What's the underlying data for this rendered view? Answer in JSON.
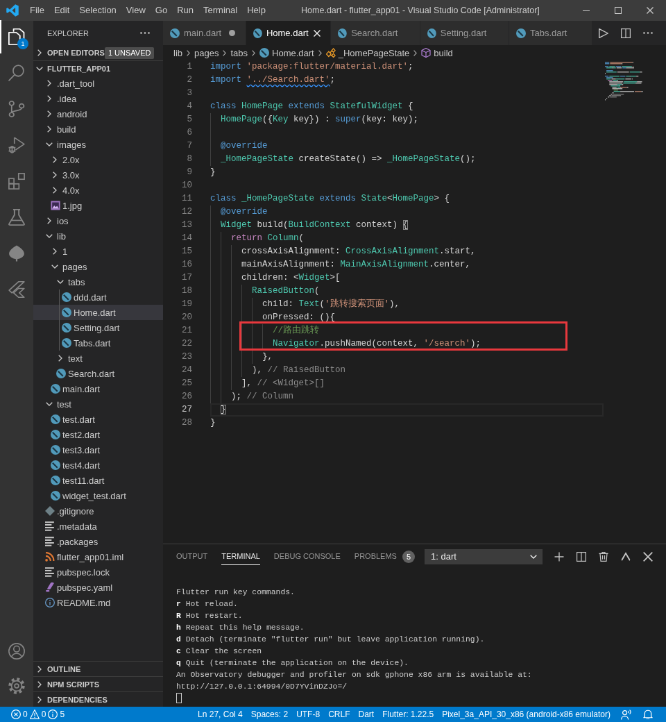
{
  "window": {
    "title": "Home.dart - flutter_app01 - Visual Studio Code [Administrator]"
  },
  "menu": [
    "File",
    "Edit",
    "Selection",
    "View",
    "Go",
    "Run",
    "Terminal",
    "Help"
  ],
  "activity_bar": {
    "items": [
      {
        "kind": "explorer",
        "selected": true,
        "badge": "1"
      },
      {
        "kind": "search",
        "selected": false
      },
      {
        "kind": "source-control",
        "selected": false
      },
      {
        "kind": "run-debug",
        "selected": false
      },
      {
        "kind": "extensions",
        "selected": false
      },
      {
        "kind": "testing",
        "selected": false
      },
      {
        "kind": "leaf",
        "selected": false
      },
      {
        "kind": "flutter",
        "selected": false
      }
    ],
    "bottom": [
      {
        "kind": "account"
      },
      {
        "kind": "settings"
      }
    ]
  },
  "sidebar": {
    "title": "EXPLORER",
    "open_editors": {
      "label": "OPEN EDITORS",
      "expanded": false,
      "badge": "1 UNSAVED"
    },
    "folder": {
      "label": "FLUTTER_APP01",
      "expanded": true,
      "items": [
        {
          "name": ".dart_tool",
          "kind": "folder",
          "expanded": false,
          "selected": false
        },
        {
          "name": ".idea",
          "kind": "folder",
          "expanded": false,
          "selected": false
        },
        {
          "name": "android",
          "kind": "folder",
          "expanded": false,
          "selected": false
        },
        {
          "name": "build",
          "kind": "folder",
          "expanded": false,
          "selected": false
        },
        {
          "name": "images",
          "kind": "folder",
          "expanded": true,
          "selected": false,
          "children": [
            {
              "name": "2.0x",
              "kind": "folder",
              "expanded": false,
              "selected": false
            },
            {
              "name": "3.0x",
              "kind": "folder",
              "expanded": false,
              "selected": false
            },
            {
              "name": "4.0x",
              "kind": "folder",
              "expanded": false,
              "selected": false
            },
            {
              "name": "1.jpg",
              "kind": "image",
              "selected": false
            }
          ]
        },
        {
          "name": "ios",
          "kind": "folder",
          "expanded": false,
          "selected": false
        },
        {
          "name": "lib",
          "kind": "folder",
          "expanded": true,
          "selected": false,
          "children": [
            {
              "name": "1",
              "kind": "folder",
              "expanded": false,
              "selected": false
            },
            {
              "name": "pages",
              "kind": "folder",
              "expanded": true,
              "selected": false,
              "children": [
                {
                  "name": "tabs",
                  "kind": "folder",
                  "expanded": true,
                  "selected": false,
                  "children": [
                    {
                      "name": "ddd.dart",
                      "kind": "dart",
                      "selected": false
                    },
                    {
                      "name": "Home.dart",
                      "kind": "dart",
                      "selected": true
                    },
                    {
                      "name": "Setting.dart",
                      "kind": "dart",
                      "selected": false
                    },
                    {
                      "name": "Tabs.dart",
                      "kind": "dart",
                      "selected": false
                    }
                  ]
                },
                {
                  "name": "text",
                  "kind": "folder",
                  "expanded": false,
                  "selected": false
                },
                {
                  "name": "Search.dart",
                  "kind": "dart",
                  "selected": false
                }
              ]
            },
            {
              "name": "main.dart",
              "kind": "dart",
              "selected": false
            }
          ]
        },
        {
          "name": "test",
          "kind": "folder",
          "expanded": true,
          "selected": false,
          "children": [
            {
              "name": "test.dart",
              "kind": "dart",
              "selected": false
            },
            {
              "name": "test2.dart",
              "kind": "dart",
              "selected": false
            },
            {
              "name": "test3.dart",
              "kind": "dart",
              "selected": false
            },
            {
              "name": "test4.dart",
              "kind": "dart",
              "selected": false
            },
            {
              "name": "test11.dart",
              "kind": "dart",
              "selected": false
            },
            {
              "name": "widget_test.dart",
              "kind": "dart",
              "selected": false
            }
          ]
        },
        {
          "name": ".gitignore",
          "kind": "git",
          "selected": false
        },
        {
          "name": ".metadata",
          "kind": "text",
          "selected": false
        },
        {
          "name": ".packages",
          "kind": "text",
          "selected": false
        },
        {
          "name": "flutter_app01.iml",
          "kind": "rss",
          "selected": false
        },
        {
          "name": "pubspec.lock",
          "kind": "text",
          "selected": false
        },
        {
          "name": "pubspec.yaml",
          "kind": "yaml",
          "selected": false
        },
        {
          "name": "README.md",
          "kind": "info",
          "selected": false
        }
      ]
    },
    "sections": [
      {
        "label": "OUTLINE",
        "expanded": false
      },
      {
        "label": "NPM SCRIPTS",
        "expanded": false
      },
      {
        "label": "DEPENDENCIES",
        "expanded": false
      }
    ]
  },
  "editor": {
    "tabs": [
      {
        "label": "main.dart",
        "selected": false,
        "dirty": true
      },
      {
        "label": "Home.dart",
        "selected": true,
        "dirty": false
      },
      {
        "label": "Search.dart",
        "selected": false,
        "dirty": false
      },
      {
        "label": "Setting.dart",
        "selected": false,
        "dirty": false
      },
      {
        "label": "Tabs.dart",
        "selected": false,
        "dirty": false
      }
    ],
    "breadcrumbs": [
      {
        "label": "lib",
        "kind": "folder"
      },
      {
        "label": "pages",
        "kind": "folder"
      },
      {
        "label": "tabs",
        "kind": "folder"
      },
      {
        "label": "Home.dart",
        "kind": "dart"
      },
      {
        "label": "_HomePageState",
        "kind": "class"
      },
      {
        "label": "build",
        "kind": "method"
      }
    ],
    "lines": [
      {
        "number": "1",
        "current": false,
        "boxed": false,
        "tokens": [
          {
            "kind": "keyword",
            "text": "import "
          },
          {
            "kind": "string",
            "text": "'package:flutter/material.dart'"
          },
          {
            "kind": "plain",
            "text": ";"
          }
        ]
      },
      {
        "number": "2",
        "current": false,
        "boxed": false,
        "tokens": [
          {
            "kind": "keyword",
            "text": "import "
          },
          {
            "kind": "flagged-string",
            "text": "'../Search.dart'"
          },
          {
            "kind": "plain",
            "text": ";"
          }
        ]
      },
      {
        "number": "3",
        "current": false,
        "boxed": false
      },
      {
        "number": "4",
        "current": false,
        "boxed": false,
        "tokens": [
          {
            "kind": "keyword",
            "text": "class "
          },
          {
            "kind": "type",
            "text": "HomePage"
          },
          {
            "kind": "keyword",
            "text": " extends "
          },
          {
            "kind": "type",
            "text": "StatefulWidget"
          },
          {
            "kind": "plain",
            "text": " {"
          }
        ]
      },
      {
        "number": "5",
        "current": false,
        "boxed": false,
        "tokens": [
          {
            "kind": "type",
            "text": "  HomePage"
          },
          {
            "kind": "plain",
            "text": "({"
          },
          {
            "kind": "type",
            "text": "Key"
          },
          {
            "kind": "plain",
            "text": " key}) : "
          },
          {
            "kind": "keyword",
            "text": "super"
          },
          {
            "kind": "plain",
            "text": "(key: key);"
          }
        ]
      },
      {
        "number": "6",
        "current": false,
        "boxed": false
      },
      {
        "number": "7",
        "current": false,
        "boxed": false,
        "tokens": [
          {
            "kind": "annotation",
            "text": "  @override"
          }
        ]
      },
      {
        "number": "8",
        "current": false,
        "boxed": false,
        "tokens": [
          {
            "kind": "type",
            "text": "  _HomePageState"
          },
          {
            "kind": "plain",
            "text": " createState() => "
          },
          {
            "kind": "type",
            "text": "_HomePageState"
          },
          {
            "kind": "plain",
            "text": "();"
          }
        ]
      },
      {
        "number": "9",
        "current": false,
        "boxed": false,
        "tokens": [
          {
            "kind": "plain",
            "text": "}"
          }
        ]
      },
      {
        "number": "10",
        "current": false,
        "boxed": false
      },
      {
        "number": "11",
        "current": false,
        "boxed": false,
        "tokens": [
          {
            "kind": "keyword",
            "text": "class "
          },
          {
            "kind": "type",
            "text": "_HomePageState"
          },
          {
            "kind": "keyword",
            "text": " extends "
          },
          {
            "kind": "type",
            "text": "State"
          },
          {
            "kind": "plain",
            "text": "<"
          },
          {
            "kind": "type",
            "text": "HomePage"
          },
          {
            "kind": "plain",
            "text": "> {"
          }
        ]
      },
      {
        "number": "12",
        "current": false,
        "boxed": false,
        "tokens": [
          {
            "kind": "annotation",
            "text": "  @override"
          }
        ]
      },
      {
        "number": "13",
        "current": false,
        "boxed": false,
        "tokens": [
          {
            "kind": "type",
            "text": "  Widget"
          },
          {
            "kind": "plain",
            "text": " build("
          },
          {
            "kind": "type",
            "text": "BuildContext"
          },
          {
            "kind": "plain",
            "text": " context) "
          },
          {
            "kind": "bracket",
            "text": "{"
          }
        ]
      },
      {
        "number": "14",
        "current": false,
        "boxed": false,
        "tokens": [
          {
            "kind": "control",
            "text": "    return "
          },
          {
            "kind": "type",
            "text": "Column"
          },
          {
            "kind": "plain",
            "text": "("
          }
        ]
      },
      {
        "number": "15",
        "current": false,
        "boxed": false,
        "tokens": [
          {
            "kind": "plain",
            "text": "      crossAxisAlignment: "
          },
          {
            "kind": "type",
            "text": "CrossAxisAlignment"
          },
          {
            "kind": "plain",
            "text": ".start,"
          }
        ]
      },
      {
        "number": "16",
        "current": false,
        "boxed": false,
        "tokens": [
          {
            "kind": "plain",
            "text": "      mainAxisAlignment: "
          },
          {
            "kind": "type",
            "text": "MainAxisAlignment"
          },
          {
            "kind": "plain",
            "text": ".center,"
          }
        ]
      },
      {
        "number": "17",
        "current": false,
        "boxed": false,
        "tokens": [
          {
            "kind": "plain",
            "text": "      children: <"
          },
          {
            "kind": "type",
            "text": "Widget"
          },
          {
            "kind": "plain",
            "text": ">["
          }
        ]
      },
      {
        "number": "18",
        "current": false,
        "boxed": false,
        "tokens": [
          {
            "kind": "type",
            "text": "        RaisedButton"
          },
          {
            "kind": "plain",
            "text": "("
          }
        ]
      },
      {
        "number": "19",
        "current": false,
        "boxed": false,
        "tokens": [
          {
            "kind": "plain",
            "text": "          child: "
          },
          {
            "kind": "type",
            "text": "Text"
          },
          {
            "kind": "plain",
            "text": "("
          },
          {
            "kind": "string",
            "text": "'跳转搜索页面'"
          },
          {
            "kind": "plain",
            "text": "),"
          }
        ]
      },
      {
        "number": "20",
        "current": false,
        "boxed": false,
        "tokens": [
          {
            "kind": "plain",
            "text": "          onPressed: (){"
          }
        ]
      },
      {
        "number": "21",
        "current": false,
        "boxed": true,
        "tokens": [
          {
            "kind": "comment",
            "text": "            //路由跳转"
          }
        ]
      },
      {
        "number": "22",
        "current": false,
        "boxed": true,
        "tokens": [
          {
            "kind": "type",
            "text": "            Navigator"
          },
          {
            "kind": "plain",
            "text": ".pushNamed(context, "
          },
          {
            "kind": "string",
            "text": "'/search'"
          },
          {
            "kind": "plain",
            "text": ");"
          }
        ]
      },
      {
        "number": "23",
        "current": false,
        "boxed": false,
        "tokens": [
          {
            "kind": "plain",
            "text": "          },"
          }
        ]
      },
      {
        "number": "24",
        "current": false,
        "boxed": false,
        "tokens": [
          {
            "kind": "plain",
            "text": "        ), "
          },
          {
            "kind": "label",
            "text": "// RaisedButton"
          }
        ]
      },
      {
        "number": "25",
        "current": false,
        "boxed": false,
        "tokens": [
          {
            "kind": "plain",
            "text": "      ], "
          },
          {
            "kind": "label",
            "text": "// <Widget>[]"
          }
        ]
      },
      {
        "number": "26",
        "current": false,
        "boxed": false,
        "tokens": [
          {
            "kind": "plain",
            "text": "    ); "
          },
          {
            "kind": "label",
            "text": "// Column"
          }
        ]
      },
      {
        "number": "27",
        "current": true,
        "boxed": false,
        "tokens": [
          {
            "kind": "bracket",
            "text": "  }"
          }
        ]
      },
      {
        "number": "28",
        "current": false,
        "boxed": false,
        "tokens": [
          {
            "kind": "plain",
            "text": "}"
          }
        ]
      }
    ]
  },
  "panel": {
    "tabs": [
      {
        "label": "OUTPUT",
        "selected": false
      },
      {
        "label": "TERMINAL",
        "selected": true
      },
      {
        "label": "DEBUG CONSOLE",
        "selected": false
      },
      {
        "label": "PROBLEMS",
        "selected": false,
        "badge": "5"
      }
    ],
    "terminal_select": "1: dart",
    "terminal_lines": [
      "Flutter run key commands.",
      "**r** Hot reload.",
      "**R** Hot restart.",
      "**h** Repeat this help message.",
      "**d** Detach (terminate \"flutter run\" but leave application running).",
      "**c** Clear the screen",
      "**q** Quit (terminate the application on the device).",
      "An Observatory debugger and profiler on sdk gphone x86 arm is available at:",
      "http://127.0.0.1:64994/0D7YVinDZJo=/"
    ]
  },
  "status_bar": {
    "problems": {
      "errors": "0",
      "warnings": "0",
      "infos": "5"
    },
    "items": [
      "Ln 27, Col 4",
      "Spaces: 2",
      "UTF-8",
      "CRLF",
      "Dart",
      "Flutter: 1.22.5",
      "Pixel_3a_API_30_x86 (android-x86 emulator)"
    ]
  }
}
